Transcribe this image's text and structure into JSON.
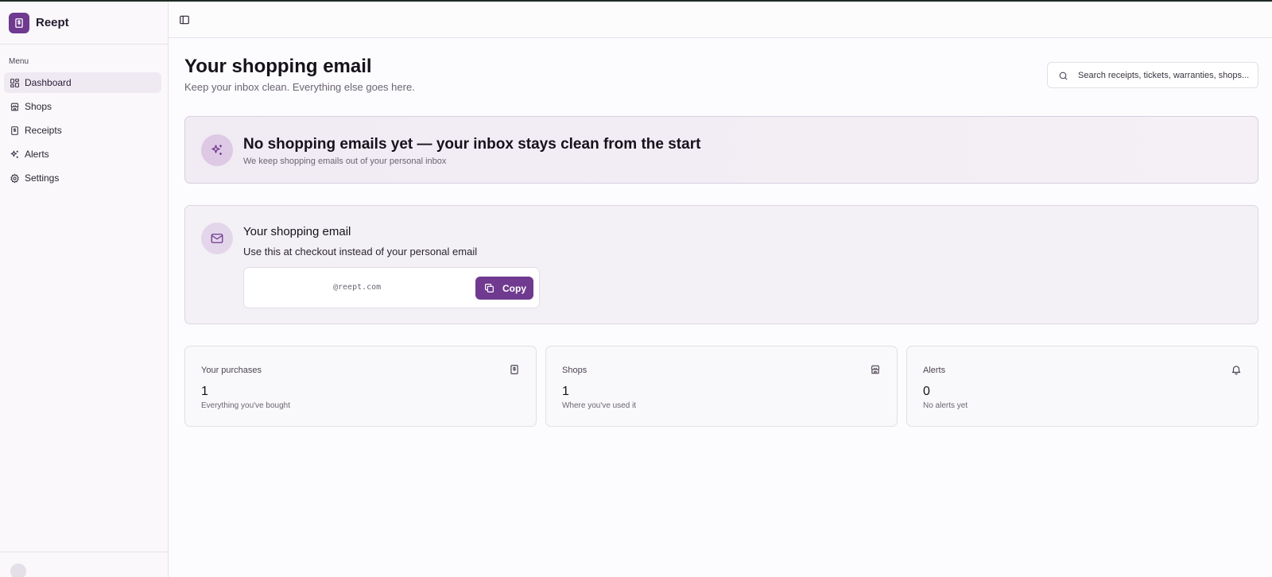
{
  "app": {
    "name": "Reept"
  },
  "sidebar": {
    "menu_label": "Menu",
    "items": [
      {
        "label": "Dashboard",
        "icon": "dashboard-icon",
        "active": true
      },
      {
        "label": "Shops",
        "icon": "store-icon",
        "active": false
      },
      {
        "label": "Receipts",
        "icon": "receipt-icon",
        "active": false
      },
      {
        "label": "Alerts",
        "icon": "sparkles-icon",
        "active": false
      },
      {
        "label": "Settings",
        "icon": "gear-icon",
        "active": false
      }
    ]
  },
  "header": {
    "title": "Your shopping email",
    "subtitle": "Keep your inbox clean. Everything else goes here."
  },
  "search": {
    "placeholder": "Search receipts, tickets, warranties, shops..."
  },
  "banner": {
    "title": "No shopping emails yet — your inbox stays clean from the start",
    "subtitle": "We keep shopping emails out of your personal inbox"
  },
  "email_card": {
    "title": "Your shopping email",
    "subtitle": "Use this at checkout instead of your personal email",
    "address": "@reept.com",
    "copy_label": "Copy"
  },
  "stats": [
    {
      "label": "Your purchases",
      "value": "1",
      "desc": "Everything you've bought",
      "icon": "receipt-icon"
    },
    {
      "label": "Shops",
      "value": "1",
      "desc": "Where you've used it",
      "icon": "store-icon"
    },
    {
      "label": "Alerts",
      "value": "0",
      "desc": "No alerts yet",
      "icon": "bell-icon"
    }
  ],
  "colors": {
    "accent": "#6f3a8f",
    "banner_bg": "#f1ebf3",
    "icon_circle": "#ddc9e4"
  }
}
